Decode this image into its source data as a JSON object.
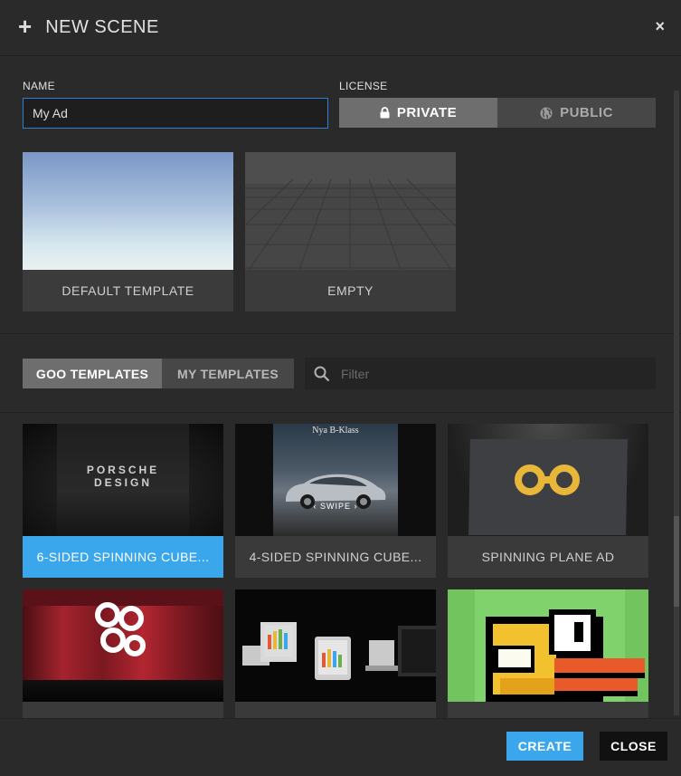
{
  "header": {
    "title": "NEW SCENE",
    "plus_glyph": "+",
    "close_glyph": "×"
  },
  "form": {
    "name_label": "NAME",
    "name_value": "My Ad",
    "license_label": "LICENSE",
    "license_options": [
      "PRIVATE",
      "PUBLIC"
    ],
    "license_selected": "PRIVATE"
  },
  "base_templates": [
    {
      "label": "DEFAULT TEMPLATE"
    },
    {
      "label": "EMPTY"
    }
  ],
  "tabs": {
    "items": [
      "GOO TEMPLATES",
      "MY TEMPLATES"
    ],
    "active": "GOO TEMPLATES"
  },
  "filter": {
    "placeholder": "Filter",
    "value": ""
  },
  "templates": [
    {
      "label": "6-SIDED SPINNING CUBE...",
      "thumb_text": "PORSCHE\nDESIGN",
      "active": true
    },
    {
      "label": "4-SIDED SPINNING CUBE...",
      "thumb_text_top": "Nya B-Klass",
      "thumb_text_mid": "‹ SWIPE ›",
      "active": false
    },
    {
      "label": "SPINNING PLANE AD",
      "active": false
    },
    {
      "label": "",
      "active": false
    },
    {
      "label": "",
      "active": false
    },
    {
      "label": "",
      "active": false
    }
  ],
  "footer": {
    "create_label": "CREATE",
    "close_label": "CLOSE"
  },
  "colors": {
    "accent": "#3aa7ec",
    "background": "#2a2a2a",
    "goo_logo": "#e8b73a"
  },
  "icons": [
    "plus-icon",
    "close-icon",
    "lock-icon",
    "globe-icon",
    "search-icon"
  ]
}
